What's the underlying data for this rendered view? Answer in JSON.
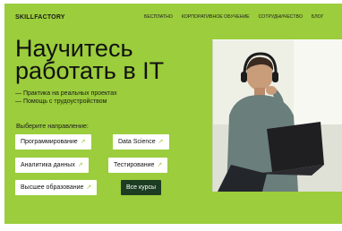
{
  "header": {
    "logo": "SKILLFACTORY",
    "nav": [
      "Бесплатно",
      "Корпоративное обучение",
      "Сотрудничество",
      "Блог"
    ]
  },
  "hero": {
    "headline_line1": "Научитесь",
    "headline_line2": "работать в IT",
    "bullets": [
      "— Практика на реальных проектах",
      "— Помощь с трудоустройством"
    ],
    "direction_label": "Выберите направление:",
    "directions": [
      {
        "label": "Программирование",
        "arrow": "↗"
      },
      {
        "label": "Data Science",
        "arrow": "↗"
      },
      {
        "label": "Аналитика данных",
        "arrow": "↗"
      },
      {
        "label": "Тестирование",
        "arrow": "↗"
      },
      {
        "label": "Высшее образование",
        "arrow": "↗"
      }
    ],
    "all_courses": "Все курсы"
  },
  "colors": {
    "accent_green": "#9bcd3c",
    "dark_button": "#1d3d22"
  },
  "icons": {
    "arrow": "arrow-up-right-icon"
  }
}
